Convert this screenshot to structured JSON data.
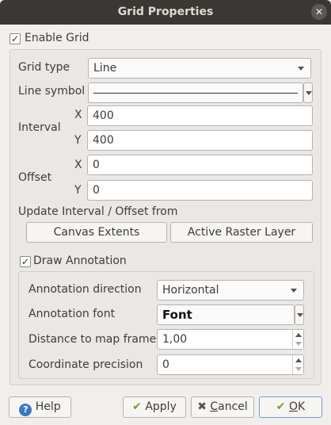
{
  "window": {
    "title": "Grid Properties",
    "close_glyph": "✕"
  },
  "enable_grid": {
    "label": "Enable Grid",
    "checked": true
  },
  "grid": {
    "type_label": "Grid type",
    "type_value": "Line",
    "line_symbol_label": "Line symbol",
    "interval_label": "Interval",
    "interval_x_label": "X",
    "interval_x": "400",
    "interval_y_label": "Y",
    "interval_y": "400",
    "offset_label": "Offset",
    "offset_x_label": "X",
    "offset_x": "0",
    "offset_y_label": "Y",
    "offset_y": "0",
    "update_from_label": "Update Interval / Offset from",
    "canvas_extents_button": "Canvas Extents",
    "active_raster_button": "Active Raster Layer"
  },
  "annotation": {
    "draw_label": "Draw Annotation",
    "checked": true,
    "direction_label": "Annotation direction",
    "direction_value": "Horizontal",
    "font_label": "Annotation font",
    "font_button": "Font",
    "distance_label": "Distance to map frame",
    "distance_value": "1,00",
    "precision_label": "Coordinate precision",
    "precision_value": "0"
  },
  "footer": {
    "help": "Help",
    "apply": "Apply",
    "cancel_prefix": "",
    "cancel_underlined": "C",
    "cancel_rest": "ancel",
    "ok_underlined": "O",
    "ok_rest": "K"
  },
  "colors": {
    "titlebar": "#393834",
    "help_icon": "#3d77c1",
    "apply_icon": "#6aa52b"
  }
}
